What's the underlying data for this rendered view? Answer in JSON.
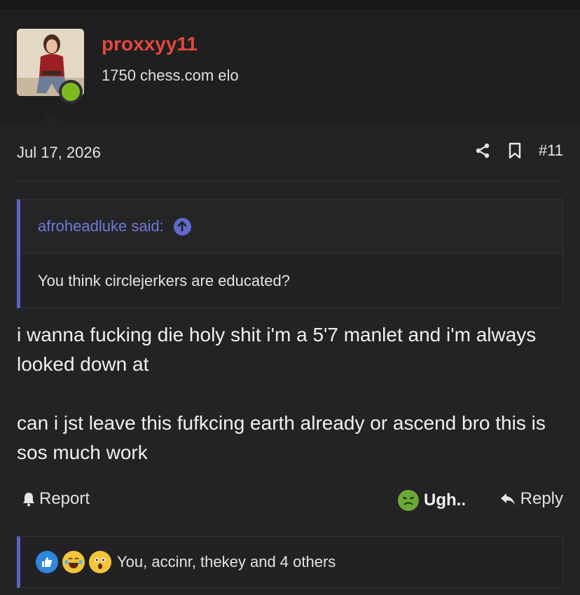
{
  "user": {
    "username": "proxxyy11",
    "title": "1750 chess.com elo",
    "status": "online",
    "username_color": "#e5473d",
    "online_color": "#7cbb1f"
  },
  "post": {
    "date": "Jul 17, 2026",
    "number": "#11",
    "icons": [
      "share-icon",
      "bookmark-icon"
    ]
  },
  "quote": {
    "author": "afroheadluke said:",
    "text": "You think circlejerkers are educated?",
    "accent": "#5a64c8"
  },
  "message": {
    "paragraph1": "i wanna fucking die holy shit i'm a 5'7 manlet and i'm always looked down at",
    "paragraph2": "can i jst leave this fufkcing earth already or ascend bro this is sos much work"
  },
  "actions": {
    "report": "Report",
    "reaction": "Ugh..",
    "reply": "Reply"
  },
  "reactions": {
    "icons": [
      "like-icon",
      "laugh-icon",
      "wow-icon"
    ],
    "text": "You, accinr, thekey and 4 others"
  }
}
